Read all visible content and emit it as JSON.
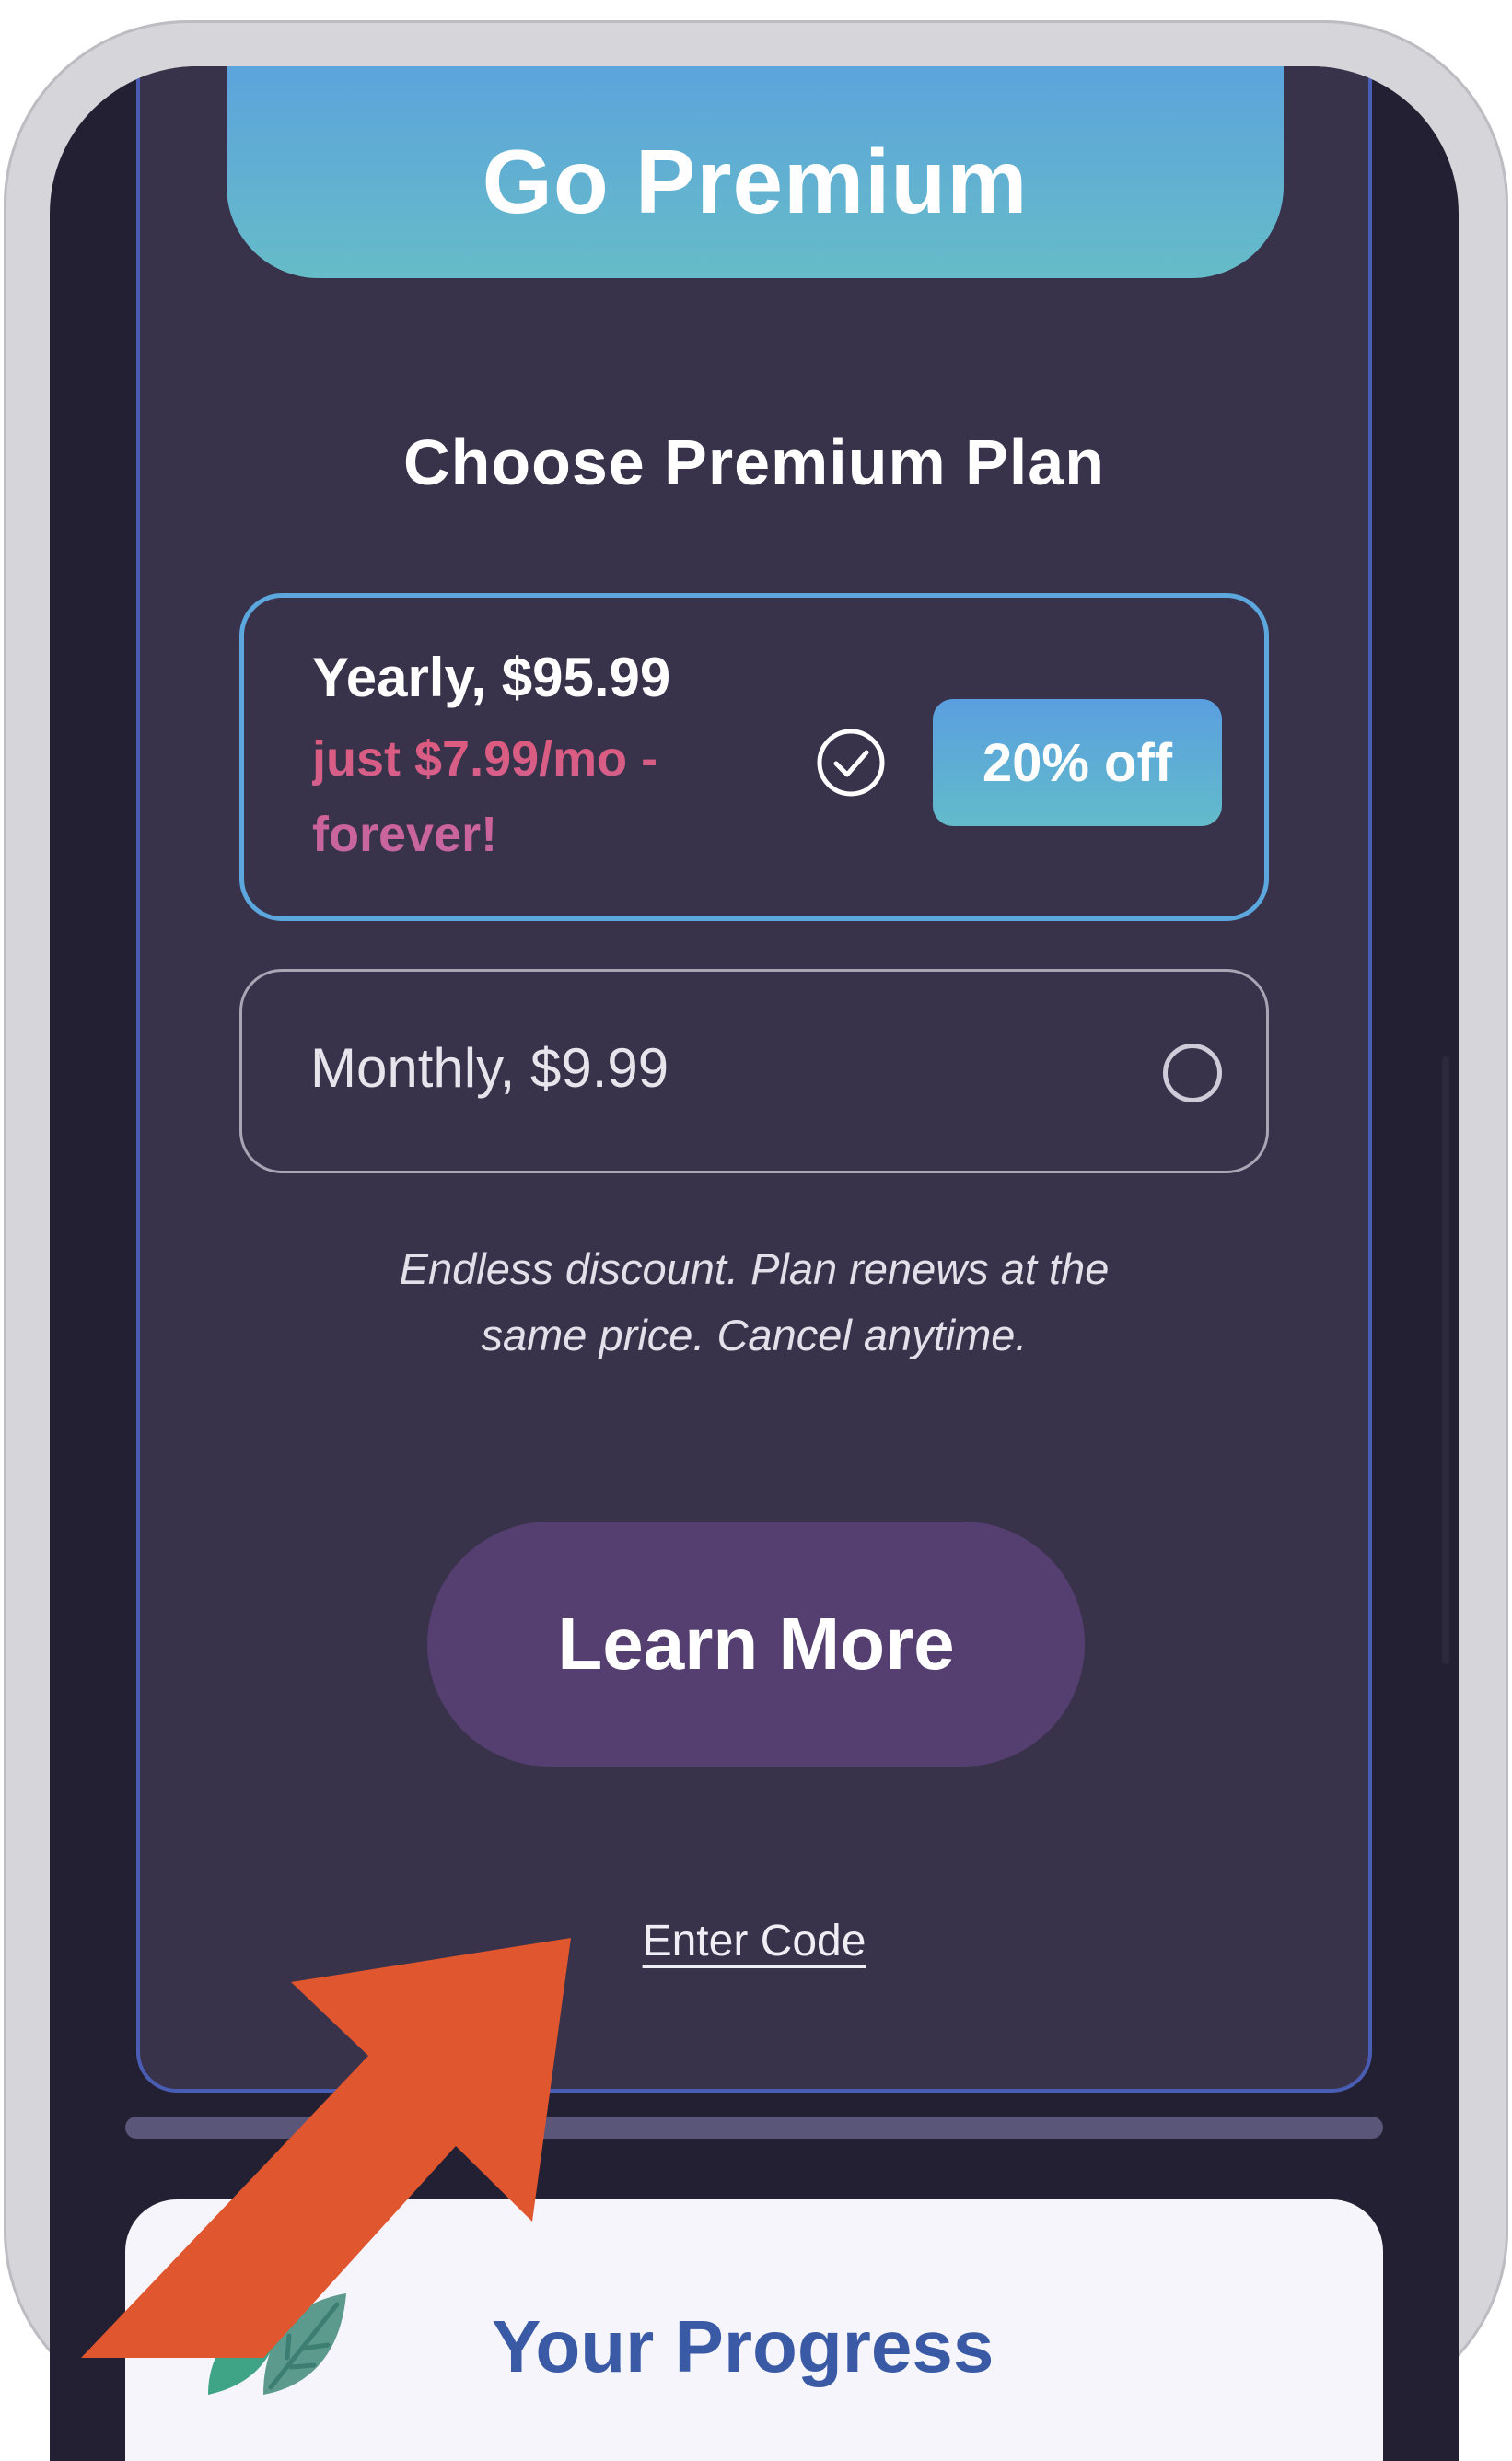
{
  "header": {
    "go_premium_label": "Go Premium"
  },
  "plans": {
    "title": "Choose Premium Plan",
    "yearly": {
      "title": "Yearly, $95.99",
      "subtitle": "just $7.99/mo - forever!",
      "badge": "20% off",
      "selected": true
    },
    "monthly": {
      "title": "Monthly, $9.99",
      "selected": false
    },
    "disclaimer_line1": "Endless discount. Plan renews at the",
    "disclaimer_line2": "same price. Cancel anytime."
  },
  "actions": {
    "learn_more_label": "Learn More",
    "enter_code_label": "Enter Code"
  },
  "progress": {
    "title": "Your Progress"
  },
  "colors": {
    "background": "#232033",
    "card": "#38324a",
    "card_border": "#4a5db5",
    "accent_blue": "#5a9fe0",
    "accent_pink": "#e05978",
    "learn_more": "#553f70",
    "arrow": "#e0562f"
  },
  "icons": {
    "selected": "check-circle-icon",
    "unselected": "radio-circle-icon",
    "progress": "leaf-icon",
    "pointer": "arrow-annotation"
  }
}
